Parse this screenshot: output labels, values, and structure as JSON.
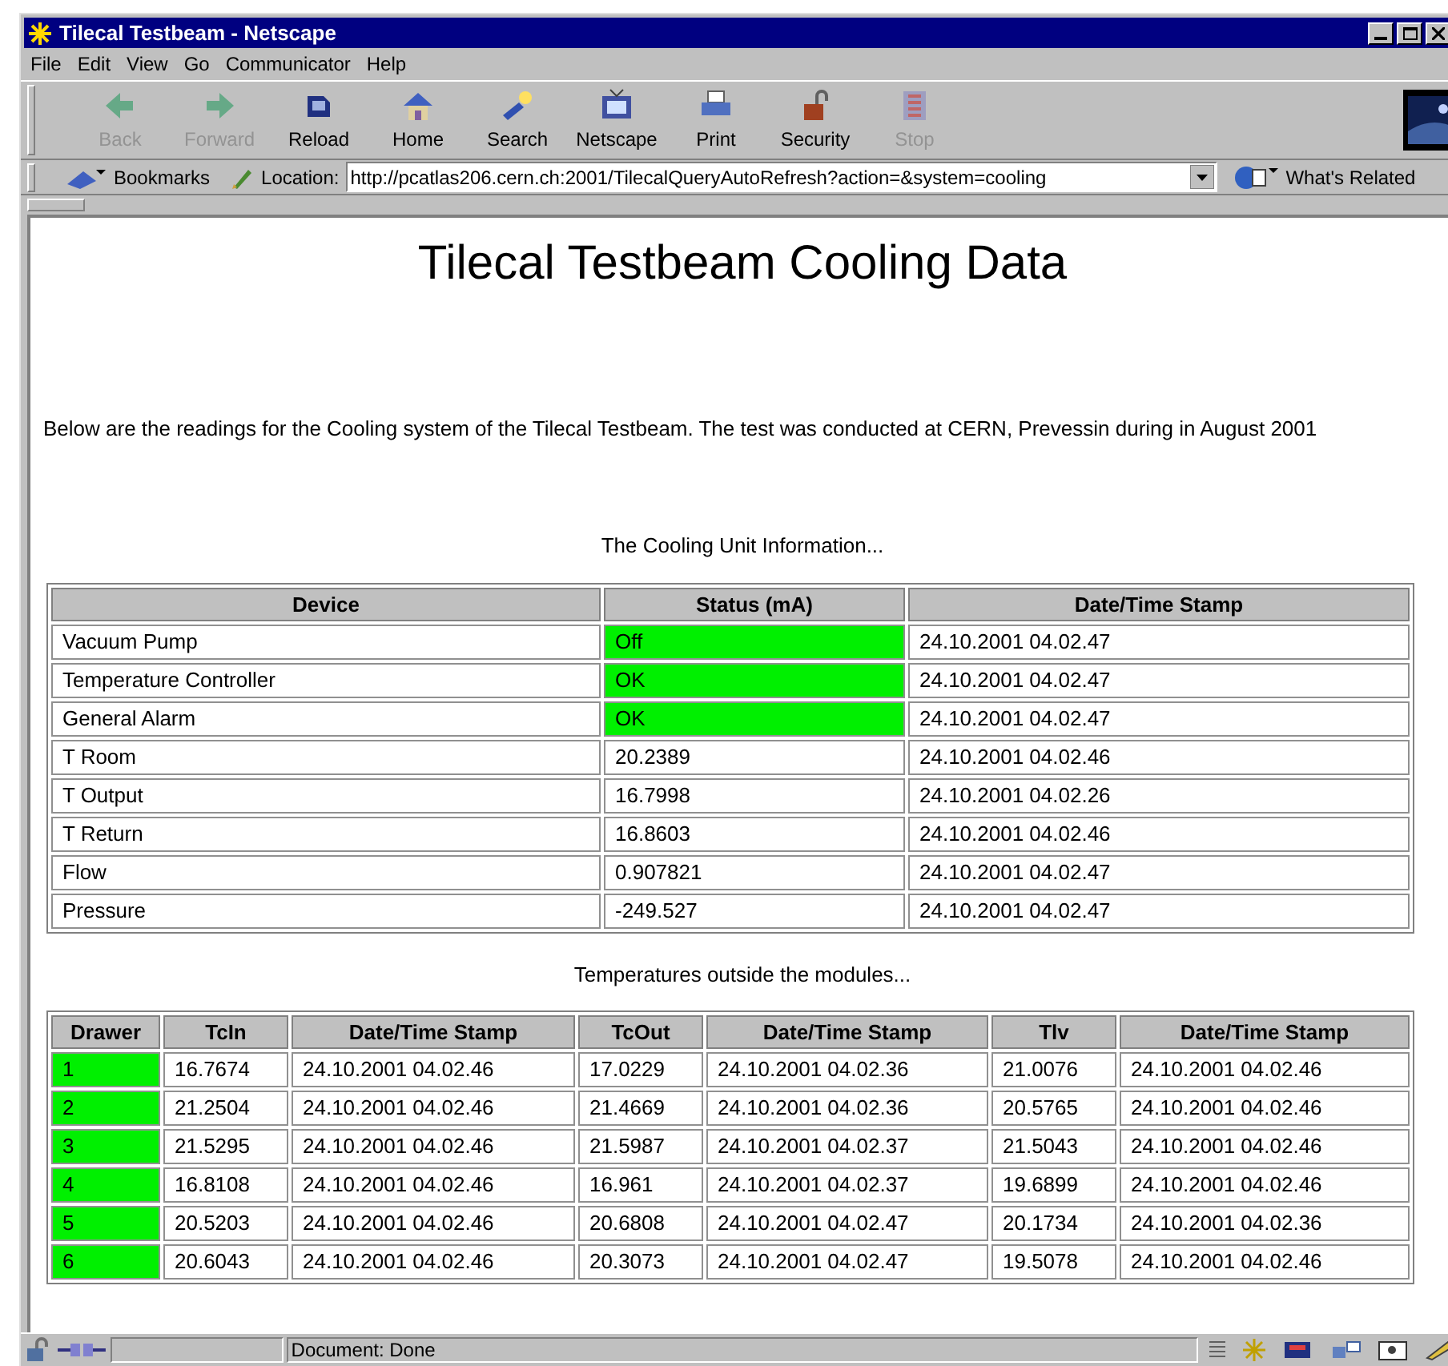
{
  "window": {
    "title": "Tilecal Testbeam - Netscape"
  },
  "menu": [
    "File",
    "Edit",
    "View",
    "Go",
    "Communicator",
    "Help"
  ],
  "toolbar": [
    {
      "label": "Back",
      "disabled": true
    },
    {
      "label": "Forward",
      "disabled": true
    },
    {
      "label": "Reload",
      "disabled": false
    },
    {
      "label": "Home",
      "disabled": false
    },
    {
      "label": "Search",
      "disabled": false
    },
    {
      "label": "Netscape",
      "disabled": false
    },
    {
      "label": "Print",
      "disabled": false
    },
    {
      "label": "Security",
      "disabled": false
    },
    {
      "label": "Stop",
      "disabled": true
    }
  ],
  "location_bar": {
    "bookmarks": "Bookmarks",
    "location_label": "Location:",
    "url": "http://pcatlas206.cern.ch:2001/TilecalQueryAutoRefresh?action=&system=cooling",
    "related": "What's Related"
  },
  "page": {
    "heading": "Tilecal Testbeam Cooling Data",
    "intro": "Below are the readings for the Cooling system of the Tilecal Testbeam. The test was conducted at CERN, Prevessin during in August 2001",
    "unit_caption": "The Cooling Unit Information...",
    "unit_table": {
      "columns": [
        "Device",
        "Status (mA)",
        "Date/Time Stamp"
      ],
      "rows": [
        {
          "device": "Vacuum Pump",
          "status": "Off",
          "ok": true,
          "stamp": "24.10.2001 04.02.47"
        },
        {
          "device": "Temperature Controller",
          "status": "OK",
          "ok": true,
          "stamp": "24.10.2001 04.02.47"
        },
        {
          "device": "General Alarm",
          "status": "OK",
          "ok": true,
          "stamp": "24.10.2001 04.02.47"
        },
        {
          "device": "T Room",
          "status": "20.2389",
          "ok": false,
          "stamp": "24.10.2001 04.02.46"
        },
        {
          "device": "T Output",
          "status": "16.7998",
          "ok": false,
          "stamp": "24.10.2001 04.02.26"
        },
        {
          "device": "T Return",
          "status": "16.8603",
          "ok": false,
          "stamp": "24.10.2001 04.02.46"
        },
        {
          "device": "Flow",
          "status": "0.907821",
          "ok": false,
          "stamp": "24.10.2001 04.02.47"
        },
        {
          "device": "Pressure",
          "status": "-249.527",
          "ok": false,
          "stamp": "24.10.2001 04.02.47"
        }
      ]
    },
    "temp_caption": "Temperatures outside the modules...",
    "temp_table": {
      "columns": [
        "Drawer",
        "TcIn",
        "Date/Time Stamp",
        "TcOut",
        "Date/Time Stamp",
        "Tlv",
        "Date/Time Stamp"
      ],
      "rows": [
        {
          "ok": true,
          "cells": [
            "1",
            "16.7674",
            "24.10.2001 04.02.46",
            "17.0229",
            "24.10.2001 04.02.36",
            "21.0076",
            "24.10.2001 04.02.46"
          ]
        },
        {
          "ok": true,
          "cells": [
            "2",
            "21.2504",
            "24.10.2001 04.02.46",
            "21.4669",
            "24.10.2001 04.02.36",
            "20.5765",
            "24.10.2001 04.02.46"
          ]
        },
        {
          "ok": true,
          "cells": [
            "3",
            "21.5295",
            "24.10.2001 04.02.46",
            "21.5987",
            "24.10.2001 04.02.37",
            "21.5043",
            "24.10.2001 04.02.46"
          ]
        },
        {
          "ok": true,
          "cells": [
            "4",
            "16.8108",
            "24.10.2001 04.02.46",
            "16.961",
            "24.10.2001 04.02.37",
            "19.6899",
            "24.10.2001 04.02.46"
          ]
        },
        {
          "ok": true,
          "cells": [
            "5",
            "20.5203",
            "24.10.2001 04.02.46",
            "20.6808",
            "24.10.2001 04.02.47",
            "20.1734",
            "24.10.2001 04.02.36"
          ]
        },
        {
          "ok": true,
          "cells": [
            "6",
            "20.6043",
            "24.10.2001 04.02.46",
            "20.3073",
            "24.10.2001 04.02.47",
            "19.5078",
            "24.10.2001 04.02.46"
          ]
        }
      ]
    }
  },
  "status_bar": {
    "text": "Document: Done"
  }
}
